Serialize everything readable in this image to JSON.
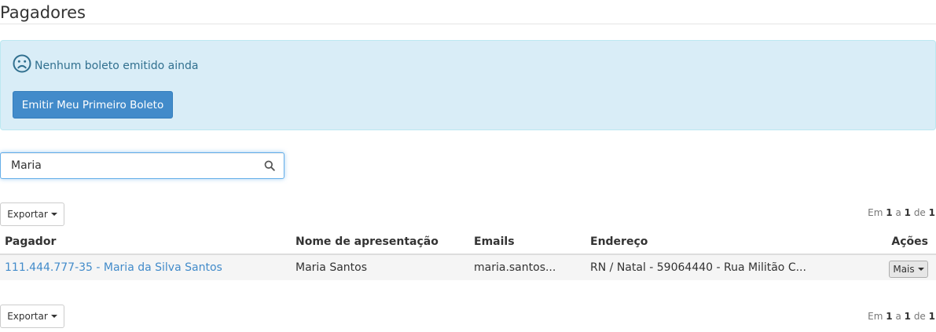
{
  "page": {
    "title": "Pagadores"
  },
  "alert": {
    "icon": "sad-face-icon",
    "message": "Nenhum boleto emitido ainda",
    "button_label": "Emitir Meu Primeiro Boleto"
  },
  "search": {
    "value": "Maria",
    "icon": "search-icon"
  },
  "toolbar": {
    "export_label": "Exportar"
  },
  "pagination": {
    "prefix": "Em",
    "from": "1",
    "sep1": "a",
    "to": "1",
    "sep2": "de",
    "total": "1"
  },
  "table": {
    "headers": {
      "pagador": "Pagador",
      "nome": "Nome de apresentação",
      "emails": "Emails",
      "endereco": "Endereço",
      "acoes": "Ações"
    },
    "rows": [
      {
        "pagador": "111.444.777-35 - Maria da Silva Santos",
        "nome": "Maria Santos",
        "emails": "maria.santos...",
        "endereco": "RN / Natal - 59064440 - Rua Militão C...",
        "action_label": "Mais"
      }
    ]
  },
  "colors": {
    "accent": "#428bca",
    "alert_bg": "#d9edf7",
    "alert_text": "#31708f",
    "row_bg": "#f5f5f5"
  }
}
